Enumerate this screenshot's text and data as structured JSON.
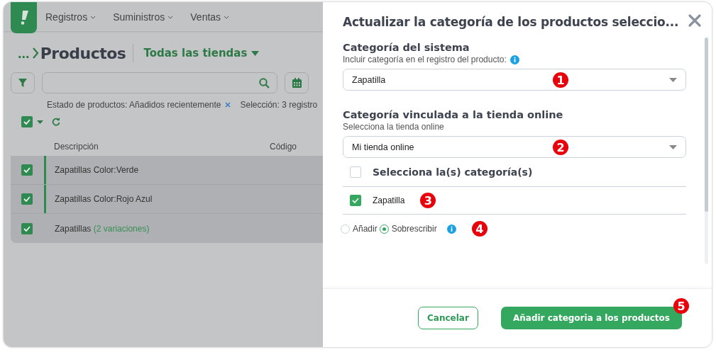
{
  "app_header": {
    "nav": [
      {
        "label": "Registros"
      },
      {
        "label": "Suministros"
      },
      {
        "label": "Ventas"
      }
    ]
  },
  "page": {
    "breadcrumb": "...",
    "title": "Productos",
    "store_selector": "Todas las tiendas",
    "filters": [
      {
        "label": "Estado de productos: Añadidos recientemente",
        "removable": true
      },
      {
        "label": "Selección: 3 registro",
        "removable": false
      }
    ],
    "select_all": {
      "checked": true
    },
    "table": {
      "columns": [
        "Descripción",
        "Código"
      ],
      "rows": [
        {
          "kind": "variant",
          "description": "Zapatillas Color:Verde",
          "checked": true
        },
        {
          "kind": "variant",
          "description": "Zapatillas Color:Rojo Azul",
          "checked": true
        },
        {
          "kind": "parent",
          "description": "Zapatillas",
          "note": "(2 variaciones)",
          "checked": true
        }
      ]
    }
  },
  "dialog": {
    "title": "Actualizar la categoría de los productos seleccio...",
    "system_category": {
      "heading": "Categoría del sistema",
      "hint": "Incluir categoría en el registro del producto:",
      "value": "Zapatilla",
      "marker": "1"
    },
    "online_category": {
      "heading": "Categoría vinculada a la tienda online",
      "hint": "Selecciona la tienda online",
      "value": "Mi tienda online",
      "marker": "2",
      "list_header": {
        "label": "Selecciona la(s) categoría(s)",
        "checked": false
      },
      "categories": [
        {
          "label": "Zapatilla",
          "checked": true,
          "marker": "3"
        }
      ]
    },
    "mode": {
      "options": [
        {
          "label": "Añadir",
          "selected": false
        },
        {
          "label": "Sobrescribir",
          "selected": true
        }
      ],
      "marker": "4"
    },
    "buttons": [
      {
        "kind": "secondary",
        "label": "Cancelar"
      },
      {
        "kind": "primary",
        "label": "Añadir categoria a los productos",
        "marker": "5"
      }
    ]
  }
}
